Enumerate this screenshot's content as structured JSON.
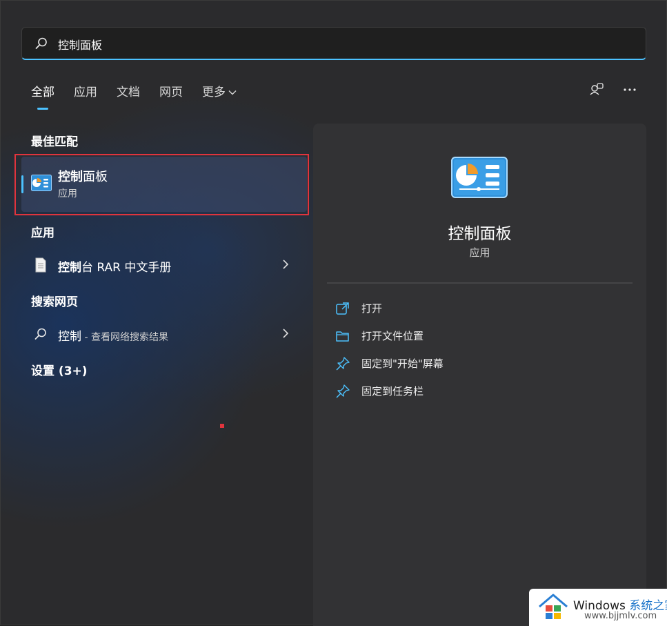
{
  "search": {
    "value": "控制面板"
  },
  "tabs": [
    {
      "label": "全部",
      "active": true
    },
    {
      "label": "应用",
      "active": false
    },
    {
      "label": "文档",
      "active": false
    },
    {
      "label": "网页",
      "active": false
    },
    {
      "label": "更多",
      "active": false
    }
  ],
  "sections": {
    "best_match": "最佳匹配",
    "apps": "应用",
    "web": "搜索网页",
    "settings": "设置 (3+)"
  },
  "best_match": {
    "name_bold": "控制",
    "name_rest": "面板",
    "kind": "应用"
  },
  "app_results": [
    {
      "name_bold": "控制",
      "name_rest": "台 RAR 中文手册"
    }
  ],
  "web_results": [
    {
      "term": "控制",
      "suffix": " - 查看网络搜索结果"
    }
  ],
  "detail": {
    "title": "控制面板",
    "kind": "应用",
    "actions": [
      {
        "label": "打开",
        "icon": "open-external-icon"
      },
      {
        "label": "打开文件位置",
        "icon": "folder-icon"
      },
      {
        "label": "固定到\"开始\"屏幕",
        "icon": "pin-icon"
      },
      {
        "label": "固定到任务栏",
        "icon": "pin-icon"
      }
    ]
  },
  "watermark": {
    "brand": "Windows",
    "brand_cn": "系统之家",
    "url": "www.bjjmlv.com"
  },
  "colors": {
    "accent": "#4cc2ff",
    "highlight_border": "#e0343d",
    "panel": "#323234"
  }
}
